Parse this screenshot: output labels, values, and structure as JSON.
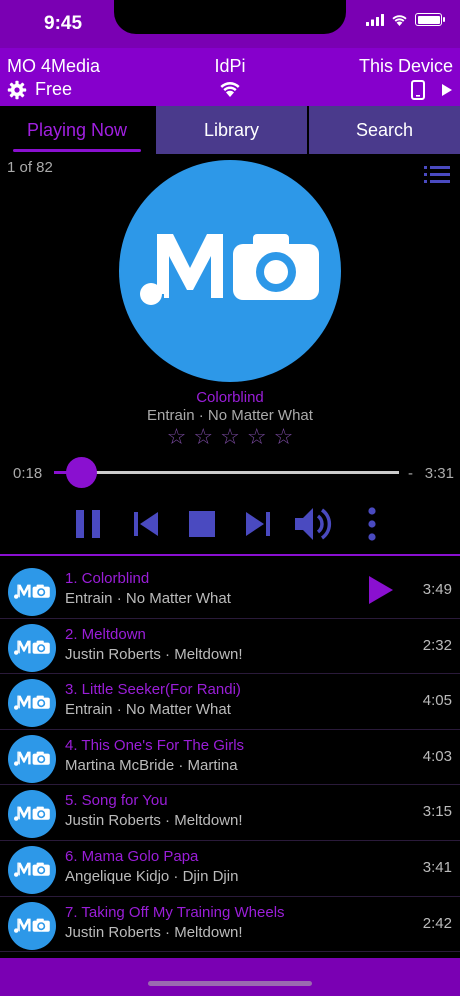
{
  "status": {
    "time": "9:45"
  },
  "header": {
    "source_name": "MO 4Media",
    "source_plan": "Free",
    "server_name": "IdPi",
    "output_name": "This Device"
  },
  "tabs": [
    {
      "label": "Playing Now",
      "active": true
    },
    {
      "label": "Library",
      "active": false
    },
    {
      "label": "Search",
      "active": false
    }
  ],
  "now_playing": {
    "position": "1 of 82",
    "title": "Colorblind",
    "subtitle": "Entrain · No Matter What",
    "rating_stars": 0,
    "rating_max": 5,
    "elapsed": "0:18",
    "remaining_prefix": "-",
    "remaining": "3:31",
    "progress": 0.078,
    "artwork_text": "MO"
  },
  "controls": [
    "pause-icon",
    "previous-icon",
    "stop-icon",
    "next-icon",
    "volume-icon",
    "more-icon"
  ],
  "queue": [
    {
      "title": "1. Colorblind",
      "subtitle": "Entrain · No Matter What",
      "duration": "3:49",
      "playing": true
    },
    {
      "title": "2. Meltdown",
      "subtitle": "Justin Roberts · Meltdown!",
      "duration": "2:32",
      "playing": false
    },
    {
      "title": "3. Little Seeker(For Randi)",
      "subtitle": "Entrain · No Matter What",
      "duration": "4:05",
      "playing": false
    },
    {
      "title": "4. This One's For The Girls",
      "subtitle": "Martina McBride · Martina",
      "duration": "4:03",
      "playing": false
    },
    {
      "title": "5. Song for You",
      "subtitle": "Justin Roberts · Meltdown!",
      "duration": "3:15",
      "playing": false
    },
    {
      "title": "6. Mama Golo Papa",
      "subtitle": "Angelique Kidjo · Djin Djin",
      "duration": "3:41",
      "playing": false
    },
    {
      "title": "7. Taking Off My Training Wheels",
      "subtitle": "Justin Roberts · Meltdown!",
      "duration": "2:42",
      "playing": false
    }
  ],
  "colors": {
    "accent": "#8a10d0",
    "header": "#8600cc",
    "tab_inactive": "#4a3a8c",
    "artwork_bg": "#2d98e8"
  }
}
